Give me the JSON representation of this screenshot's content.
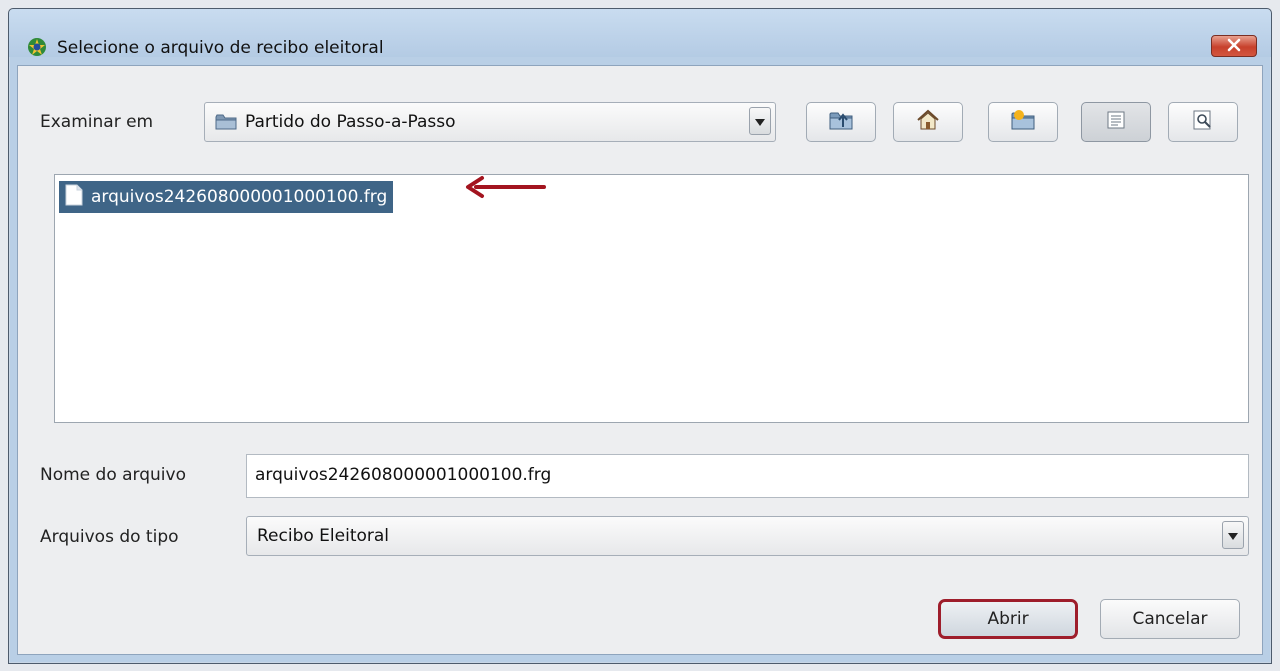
{
  "window": {
    "title": "Selecione o arquivo de recibo eleitoral",
    "close_label": "✕"
  },
  "look_in": {
    "label": "Examinar em",
    "value": "Partido do Passo-a-Passo"
  },
  "toolbar": {
    "buttons": [
      {
        "icon": "up-folder-icon"
      },
      {
        "icon": "home-icon"
      },
      {
        "icon": "new-folder-icon"
      },
      {
        "icon": "list-view-icon",
        "active": true
      },
      {
        "icon": "details-view-icon"
      }
    ]
  },
  "files": [
    {
      "name": "arquivos242608000001000100.frg",
      "selected": true
    }
  ],
  "annotation": {
    "arrow_color": "#a3141f"
  },
  "filename": {
    "label": "Nome do arquivo",
    "value": "arquivos242608000001000100.frg"
  },
  "filetype": {
    "label": "Arquivos do tipo",
    "value": "Recibo Eleitoral"
  },
  "buttons": {
    "open": "Abrir",
    "cancel": "Cancelar"
  },
  "colors": {
    "selection": "#3f6587",
    "primary_outline": "#9e1d2b",
    "close_button": "#c7412c"
  }
}
